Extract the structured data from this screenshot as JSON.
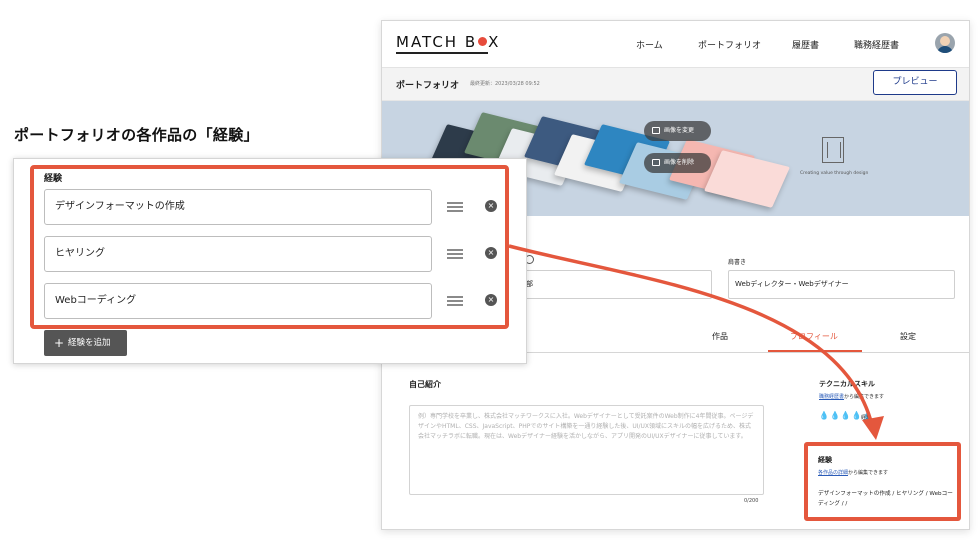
{
  "callout": {
    "heading": "ポートフォリオの各作品の「経験」",
    "section_label": "経験",
    "items": [
      "デザインフォーマットの作成",
      "ヒヤリング",
      "Webコーディング"
    ],
    "add_label": "経験を追加"
  },
  "app": {
    "logo_left": "MATCH B",
    "logo_right": "X",
    "nav": [
      "ホーム",
      "ポートフォリオ",
      "履歴書",
      "職務経歴書"
    ],
    "subbar": {
      "title": "ポートフォリオ",
      "date": "最終更新：2023/03/28 09:52",
      "preview_label": "プレビュー"
    },
    "hero": {
      "change_image": "画像を変更",
      "delete_image": "画像を削除",
      "tagline": "Creating value through design"
    },
    "fields": {
      "left_value": "一部",
      "title_label": "肩書き",
      "title_value": "Webディレクター・Webデザイナー"
    },
    "tabs": [
      "作品",
      "プロフィール",
      "設定"
    ],
    "self_intro": {
      "title": "自己紹介",
      "placeholder": "例）専門学校を卒業し、株式会社マッチワークスに入社。Webデザイナーとして受託案件のWeb制作に4年間従事。ページデザインやHTML、CSS、JavaScript、PHPでのサイト構築を一通り経験した後、UI/UX領域にスキルの幅を広げるため、株式会社マッチラボに転職。現在は、Webデザイナー経験を活かしながら、アプリ開発のUI/UXデザイナーに従事しています。",
      "count": "0/200"
    },
    "skills": {
      "title": "テクニカルスキル",
      "link": "職務経歴書",
      "note_suffix": "から編集できます",
      "level_label": "経験"
    },
    "experience": {
      "title": "経験",
      "link": "各作品の詳細",
      "note_suffix": "から編集できます",
      "list": "デザインフォーマットの作成 / ヒヤリング / Webコーディング / /"
    }
  },
  "colors": {
    "accent": "#e4573d",
    "brand_blue": "#1e3a8a",
    "button_dark": "#555555"
  }
}
